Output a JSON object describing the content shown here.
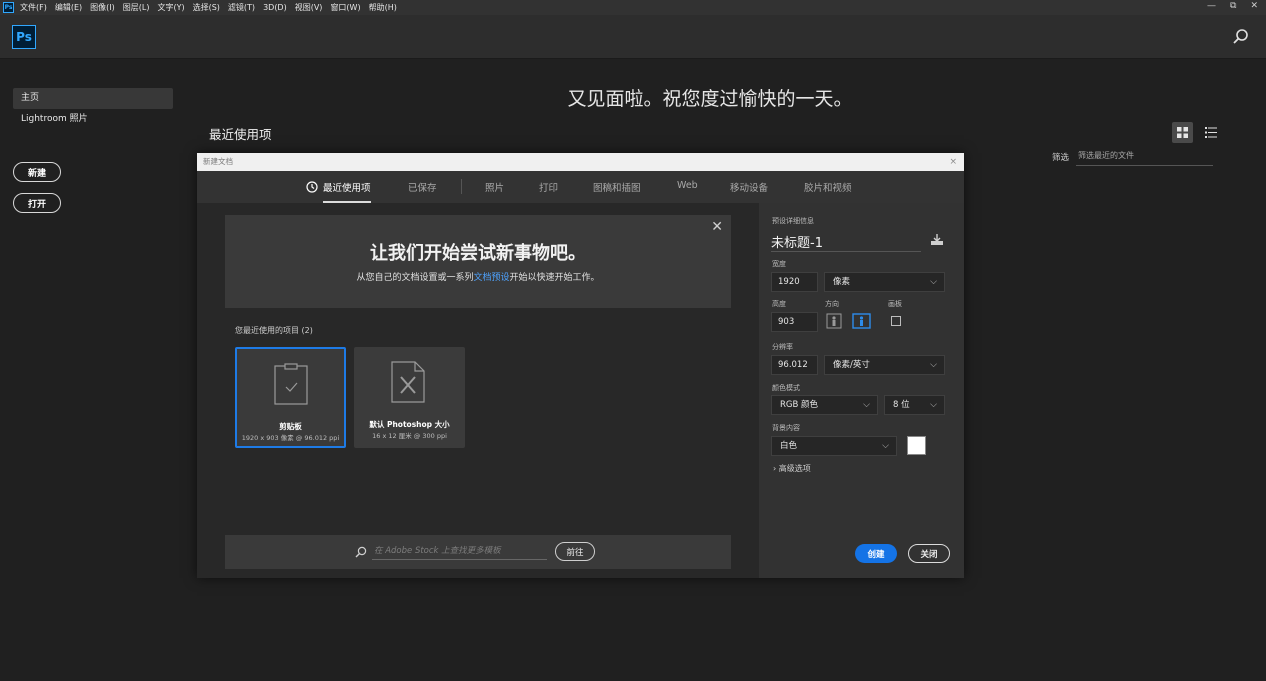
{
  "menubar": {
    "app_icon": "Ps",
    "items": [
      "文件(F)",
      "编辑(E)",
      "图像(I)",
      "图层(L)",
      "文字(Y)",
      "选择(S)",
      "滤镜(T)",
      "3D(D)",
      "视图(V)",
      "窗口(W)",
      "帮助(H)"
    ],
    "window_controls": {
      "minimize": "—",
      "restore": "⧉",
      "close": "✕"
    }
  },
  "header": {
    "logo": "Ps",
    "search_icon": "search-icon"
  },
  "sidebar": {
    "items": [
      {
        "label": "主页",
        "active": true
      },
      {
        "label": "Lightroom 照片",
        "active": false
      }
    ],
    "new_button": "新建",
    "open_button": "打开"
  },
  "home": {
    "greeting": "又见面啦。祝您度过愉快的一天。",
    "recent_title": "最近使用项",
    "filter_label": "筛选",
    "filter_placeholder": "筛选最近的文件"
  },
  "dialog": {
    "title": "新建文档",
    "close": "×",
    "tabs": [
      "最近使用项",
      "已保存",
      "照片",
      "打印",
      "图稿和插图",
      "Web",
      "移动设备",
      "胶片和视频"
    ],
    "active_tab": "最近使用项",
    "banner": {
      "title": "让我们开始尝试新事物吧。",
      "sub_before": "从您自己的文档设置或一系列",
      "sub_link": "文档预设",
      "sub_after": "开始以快速开始工作。",
      "close": "✕"
    },
    "recent_label": "您最近使用的项目  (2)",
    "cards": [
      {
        "name": "剪贴板",
        "desc": "1920 x 903 像素 @ 96.012 ppi",
        "selected": true
      },
      {
        "name": "默认 Photoshop 大小",
        "desc": "16 x 12 厘米 @ 300 ppi",
        "selected": false
      }
    ],
    "stock": {
      "placeholder": "在 Adobe Stock 上查找更多模板",
      "go_button": "前往"
    },
    "preset": {
      "section_label": "预设详细信息",
      "name": "未标题-1",
      "width_label": "宽度",
      "width": "1920",
      "width_unit": "像素",
      "height_label": "高度",
      "height": "903",
      "orientation_label": "方向",
      "artboard_label": "画板",
      "resolution_label": "分辨率",
      "resolution": "96.012",
      "resolution_unit": "像素/英寸",
      "color_mode_label": "颜色模式",
      "color_mode": "RGB 颜色",
      "bit_depth": "8 位",
      "background_label": "背景内容",
      "background": "白色",
      "background_color": "#ffffff",
      "advanced": "高级选项",
      "create_button": "创建",
      "close_button": "关闭"
    }
  },
  "colors": {
    "accent": "#1473e6",
    "ps_blue": "#31a8ff",
    "link": "#4ea3ff"
  }
}
